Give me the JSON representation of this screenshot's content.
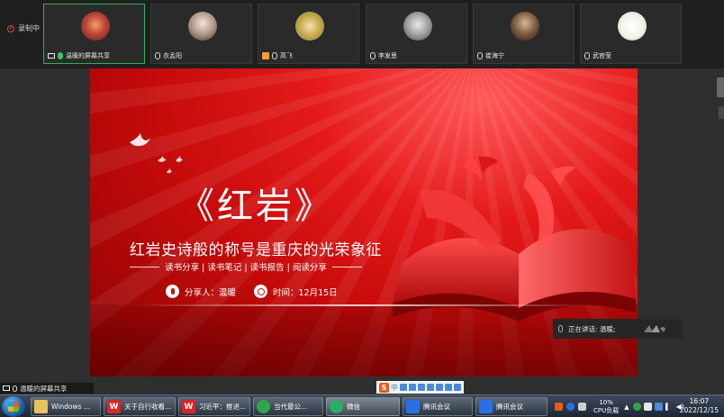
{
  "recording": {
    "label": "录制中"
  },
  "participants": [
    {
      "name": "温暖的屏幕共享",
      "sharing": true,
      "mic": "on",
      "avatar_color": "#c0463a"
    },
    {
      "name": "衣孟阳",
      "mic": "off",
      "avatar_color": "#d8c8b8"
    },
    {
      "name": "高飞",
      "mic": "off",
      "camera": "off",
      "avatar_color": "#e8d6a8"
    },
    {
      "name": "李发思",
      "mic": "off",
      "avatar_color": "#8c8c8c"
    },
    {
      "name": "崔海宁",
      "mic": "off",
      "avatar_color": "#6a5a4a"
    },
    {
      "name": "武官莹",
      "mic": "off",
      "avatar_color": "#f2f2ea"
    }
  ],
  "slide": {
    "title": "《红岩》",
    "subtitle": "红岩史诗般的称号是重庆的光荣象征",
    "tags": "读书分享 | 读书笔记 | 读书报告 | 阅读分享",
    "presenter": "分享人：温暖",
    "time": "时间：12月15日"
  },
  "speaking": {
    "label": "正在讲话: 温暖;"
  },
  "share_badge": {
    "label": "温暖的屏幕共享"
  },
  "ime": {
    "mode": "中"
  },
  "taskbar": {
    "items": [
      {
        "label": "Windows ...",
        "icon": "folder-icon",
        "color": "#e8c25a"
      },
      {
        "label": "关于自行收看...",
        "icon": "wps-icon",
        "color": "#d8262a"
      },
      {
        "label": "习近平：推进...",
        "icon": "wps-icon",
        "color": "#d8262a"
      },
      {
        "label": "当代最公...",
        "icon": "browser-icon",
        "color": "#2ca84a"
      },
      {
        "label": "微信",
        "icon": "wechat-icon",
        "color": "#2aae67"
      },
      {
        "label": "腾讯会议",
        "icon": "tencent-meeting-icon",
        "color": "#2a6fe8"
      },
      {
        "label": "腾讯会议",
        "icon": "tencent-meeting-icon",
        "color": "#2a6fe8"
      }
    ],
    "cpu": "10%",
    "cpu_label": "CPU负载",
    "time": "16:07",
    "date": "2022/12/15"
  }
}
